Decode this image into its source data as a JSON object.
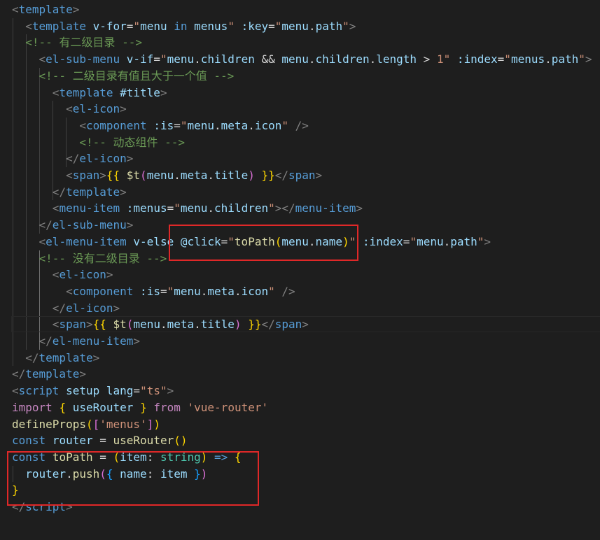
{
  "code_lines": [
    [
      {
        "t": "<",
        "c": "pun"
      },
      {
        "t": "template",
        "c": "tag"
      },
      {
        "t": ">",
        "c": "pun"
      }
    ],
    [
      {
        "t": "  "
      },
      {
        "t": "<",
        "c": "pun"
      },
      {
        "t": "template",
        "c": "tag"
      },
      {
        "t": " "
      },
      {
        "t": "v-for",
        "c": "attr"
      },
      {
        "t": "=",
        "c": "plain"
      },
      {
        "t": "\"",
        "c": "val"
      },
      {
        "t": "menu",
        "c": "var"
      },
      {
        "t": " "
      },
      {
        "t": "in",
        "c": "kw"
      },
      {
        "t": " "
      },
      {
        "t": "menus",
        "c": "var"
      },
      {
        "t": "\"",
        "c": "val"
      },
      {
        "t": " "
      },
      {
        "t": ":key",
        "c": "attr"
      },
      {
        "t": "=",
        "c": "plain"
      },
      {
        "t": "\"",
        "c": "val"
      },
      {
        "t": "menu",
        "c": "var"
      },
      {
        "t": ".",
        "c": "plain"
      },
      {
        "t": "path",
        "c": "var"
      },
      {
        "t": "\"",
        "c": "val"
      },
      {
        "t": ">",
        "c": "pun"
      }
    ],
    [
      {
        "t": "  "
      },
      {
        "t": "<!-- 有二级目录 -->",
        "c": "cmt"
      }
    ],
    [
      {
        "t": "    "
      },
      {
        "t": "<",
        "c": "pun"
      },
      {
        "t": "el-sub-menu",
        "c": "tag"
      },
      {
        "t": " "
      },
      {
        "t": "v-if",
        "c": "attr"
      },
      {
        "t": "=",
        "c": "plain"
      },
      {
        "t": "\"",
        "c": "val"
      },
      {
        "t": "menu",
        "c": "var"
      },
      {
        "t": ".",
        "c": "plain"
      },
      {
        "t": "children",
        "c": "var"
      },
      {
        "t": " && ",
        "c": "plain"
      },
      {
        "t": "menu",
        "c": "var"
      },
      {
        "t": ".",
        "c": "plain"
      },
      {
        "t": "children",
        "c": "var"
      },
      {
        "t": ".",
        "c": "plain"
      },
      {
        "t": "length",
        "c": "var"
      },
      {
        "t": " > ",
        "c": "plain"
      },
      {
        "t": "1",
        "c": "val"
      },
      {
        "t": "\"",
        "c": "val"
      },
      {
        "t": " "
      },
      {
        "t": ":index",
        "c": "attr"
      },
      {
        "t": "=",
        "c": "plain"
      },
      {
        "t": "\"",
        "c": "val"
      },
      {
        "t": "menus",
        "c": "var"
      },
      {
        "t": ".",
        "c": "plain"
      },
      {
        "t": "path",
        "c": "var"
      },
      {
        "t": "\"",
        "c": "val"
      },
      {
        "t": ">",
        "c": "pun"
      }
    ],
    [
      {
        "t": "    "
      },
      {
        "t": "<!-- 二级目录有值且大于一个值 -->",
        "c": "cmt"
      }
    ],
    [
      {
        "t": "      "
      },
      {
        "t": "<",
        "c": "pun"
      },
      {
        "t": "template",
        "c": "tag"
      },
      {
        "t": " "
      },
      {
        "t": "#title",
        "c": "attr"
      },
      {
        "t": ">",
        "c": "pun"
      }
    ],
    [
      {
        "t": "        "
      },
      {
        "t": "<",
        "c": "pun"
      },
      {
        "t": "el-icon",
        "c": "tag"
      },
      {
        "t": ">",
        "c": "pun"
      }
    ],
    [
      {
        "t": "          "
      },
      {
        "t": "<",
        "c": "pun"
      },
      {
        "t": "component",
        "c": "tag"
      },
      {
        "t": " "
      },
      {
        "t": ":is",
        "c": "attr"
      },
      {
        "t": "=",
        "c": "plain"
      },
      {
        "t": "\"",
        "c": "val"
      },
      {
        "t": "menu",
        "c": "var"
      },
      {
        "t": ".",
        "c": "plain"
      },
      {
        "t": "meta",
        "c": "var"
      },
      {
        "t": ".",
        "c": "plain"
      },
      {
        "t": "icon",
        "c": "var"
      },
      {
        "t": "\"",
        "c": "val"
      },
      {
        "t": " "
      },
      {
        "t": "/>",
        "c": "pun"
      }
    ],
    [
      {
        "t": "          "
      },
      {
        "t": "<!-- 动态组件 -->",
        "c": "cmt"
      }
    ],
    [
      {
        "t": "        "
      },
      {
        "t": "</",
        "c": "pun"
      },
      {
        "t": "el-icon",
        "c": "tag"
      },
      {
        "t": ">",
        "c": "pun"
      }
    ],
    [
      {
        "t": "        "
      },
      {
        "t": "<",
        "c": "pun"
      },
      {
        "t": "span",
        "c": "tag"
      },
      {
        "t": ">",
        "c": "pun"
      },
      {
        "t": "{{",
        "c": "b1"
      },
      {
        "t": " "
      },
      {
        "t": "$t",
        "c": "fn"
      },
      {
        "t": "(",
        "c": "b2"
      },
      {
        "t": "menu",
        "c": "var"
      },
      {
        "t": ".",
        "c": "plain"
      },
      {
        "t": "meta",
        "c": "var"
      },
      {
        "t": ".",
        "c": "plain"
      },
      {
        "t": "title",
        "c": "var"
      },
      {
        "t": ")",
        "c": "b2"
      },
      {
        "t": " "
      },
      {
        "t": "}}",
        "c": "b1"
      },
      {
        "t": "</",
        "c": "pun"
      },
      {
        "t": "span",
        "c": "tag"
      },
      {
        "t": ">",
        "c": "pun"
      }
    ],
    [
      {
        "t": "      "
      },
      {
        "t": "</",
        "c": "pun"
      },
      {
        "t": "template",
        "c": "tag"
      },
      {
        "t": ">",
        "c": "pun"
      }
    ],
    [
      {
        "t": "      "
      },
      {
        "t": "<",
        "c": "pun"
      },
      {
        "t": "menu-item",
        "c": "tag"
      },
      {
        "t": " "
      },
      {
        "t": ":menus",
        "c": "attr"
      },
      {
        "t": "=",
        "c": "plain"
      },
      {
        "t": "\"",
        "c": "val"
      },
      {
        "t": "menu",
        "c": "var"
      },
      {
        "t": ".",
        "c": "plain"
      },
      {
        "t": "children",
        "c": "var"
      },
      {
        "t": "\"",
        "c": "val"
      },
      {
        "t": ">",
        "c": "pun"
      },
      {
        "t": "</",
        "c": "pun"
      },
      {
        "t": "menu-item",
        "c": "tag"
      },
      {
        "t": ">",
        "c": "pun"
      }
    ],
    [
      {
        "t": "    "
      },
      {
        "t": "</",
        "c": "pun"
      },
      {
        "t": "el-sub-menu",
        "c": "tag"
      },
      {
        "t": ">",
        "c": "pun"
      }
    ],
    [
      {
        "t": "    "
      },
      {
        "t": "<",
        "c": "pun"
      },
      {
        "t": "el-menu-item",
        "c": "tag"
      },
      {
        "t": " "
      },
      {
        "t": "v-else",
        "c": "attr"
      },
      {
        "t": " "
      },
      {
        "t": "@click",
        "c": "attr"
      },
      {
        "t": "=",
        "c": "plain"
      },
      {
        "t": "\"",
        "c": "val"
      },
      {
        "t": "toPath",
        "c": "fn"
      },
      {
        "t": "(",
        "c": "b1"
      },
      {
        "t": "menu",
        "c": "var"
      },
      {
        "t": ".",
        "c": "plain"
      },
      {
        "t": "name",
        "c": "var"
      },
      {
        "t": ")",
        "c": "b1"
      },
      {
        "t": "\"",
        "c": "val"
      },
      {
        "t": " "
      },
      {
        "t": ":index",
        "c": "attr"
      },
      {
        "t": "=",
        "c": "plain"
      },
      {
        "t": "\"",
        "c": "val"
      },
      {
        "t": "menu",
        "c": "var"
      },
      {
        "t": ".",
        "c": "plain"
      },
      {
        "t": "path",
        "c": "var"
      },
      {
        "t": "\"",
        "c": "val"
      },
      {
        "t": ">",
        "c": "pun"
      }
    ],
    [
      {
        "t": "    "
      },
      {
        "t": "<!-- 没有二级目录 -->",
        "c": "cmt"
      }
    ],
    [
      {
        "t": "      "
      },
      {
        "t": "<",
        "c": "pun"
      },
      {
        "t": "el-icon",
        "c": "tag"
      },
      {
        "t": ">",
        "c": "pun"
      }
    ],
    [
      {
        "t": "        "
      },
      {
        "t": "<",
        "c": "pun"
      },
      {
        "t": "component",
        "c": "tag"
      },
      {
        "t": " "
      },
      {
        "t": ":is",
        "c": "attr"
      },
      {
        "t": "=",
        "c": "plain"
      },
      {
        "t": "\"",
        "c": "val"
      },
      {
        "t": "menu",
        "c": "var"
      },
      {
        "t": ".",
        "c": "plain"
      },
      {
        "t": "meta",
        "c": "var"
      },
      {
        "t": ".",
        "c": "plain"
      },
      {
        "t": "icon",
        "c": "var"
      },
      {
        "t": "\"",
        "c": "val"
      },
      {
        "t": " "
      },
      {
        "t": "/>",
        "c": "pun"
      }
    ],
    [
      {
        "t": "      "
      },
      {
        "t": "</",
        "c": "pun"
      },
      {
        "t": "el-icon",
        "c": "tag"
      },
      {
        "t": ">",
        "c": "pun"
      }
    ],
    [
      {
        "t": "      "
      },
      {
        "t": "<",
        "c": "pun"
      },
      {
        "t": "span",
        "c": "tag"
      },
      {
        "t": ">",
        "c": "pun"
      },
      {
        "t": "{{",
        "c": "b1"
      },
      {
        "t": " "
      },
      {
        "t": "$t",
        "c": "fn"
      },
      {
        "t": "(",
        "c": "b2"
      },
      {
        "t": "menu",
        "c": "var"
      },
      {
        "t": ".",
        "c": "plain"
      },
      {
        "t": "meta",
        "c": "var"
      },
      {
        "t": ".",
        "c": "plain"
      },
      {
        "t": "title",
        "c": "var"
      },
      {
        "t": ")",
        "c": "b2"
      },
      {
        "t": " "
      },
      {
        "t": "}}",
        "c": "b1"
      },
      {
        "t": "</",
        "c": "pun"
      },
      {
        "t": "span",
        "c": "tag"
      },
      {
        "t": ">",
        "c": "pun"
      }
    ],
    [
      {
        "t": "    "
      },
      {
        "t": "</",
        "c": "pun"
      },
      {
        "t": "el-menu-item",
        "c": "tag"
      },
      {
        "t": ">",
        "c": "pun"
      }
    ],
    [
      {
        "t": "  "
      },
      {
        "t": "</",
        "c": "pun"
      },
      {
        "t": "template",
        "c": "tag"
      },
      {
        "t": ">",
        "c": "pun"
      }
    ],
    [
      {
        "t": "</",
        "c": "pun"
      },
      {
        "t": "template",
        "c": "tag"
      },
      {
        "t": ">",
        "c": "pun"
      }
    ],
    [
      {
        "t": "<",
        "c": "pun"
      },
      {
        "t": "script",
        "c": "tag"
      },
      {
        "t": " "
      },
      {
        "t": "setup",
        "c": "attr"
      },
      {
        "t": " "
      },
      {
        "t": "lang",
        "c": "attr"
      },
      {
        "t": "=",
        "c": "plain"
      },
      {
        "t": "\"ts\"",
        "c": "val"
      },
      {
        "t": ">",
        "c": "pun"
      }
    ],
    [
      {
        "t": "import",
        "c": "ctrl"
      },
      {
        "t": " "
      },
      {
        "t": "{",
        "c": "b1"
      },
      {
        "t": " "
      },
      {
        "t": "useRouter",
        "c": "var"
      },
      {
        "t": " "
      },
      {
        "t": "}",
        "c": "b1"
      },
      {
        "t": " "
      },
      {
        "t": "from",
        "c": "ctrl"
      },
      {
        "t": " "
      },
      {
        "t": "'vue-router'",
        "c": "val"
      }
    ],
    [
      {
        "t": "defineProps",
        "c": "fn"
      },
      {
        "t": "(",
        "c": "b1"
      },
      {
        "t": "[",
        "c": "b2"
      },
      {
        "t": "'menus'",
        "c": "val"
      },
      {
        "t": "]",
        "c": "b2"
      },
      {
        "t": ")",
        "c": "b1"
      }
    ],
    [
      {
        "t": "const",
        "c": "kw"
      },
      {
        "t": " "
      },
      {
        "t": "router",
        "c": "var"
      },
      {
        "t": " = ",
        "c": "plain"
      },
      {
        "t": "useRouter",
        "c": "fn"
      },
      {
        "t": "(",
        "c": "b1"
      },
      {
        "t": ")",
        "c": "b1"
      }
    ],
    [
      {
        "t": "const",
        "c": "kw"
      },
      {
        "t": " "
      },
      {
        "t": "toPath",
        "c": "fn"
      },
      {
        "t": " = ",
        "c": "plain"
      },
      {
        "t": "(",
        "c": "b1"
      },
      {
        "t": "item",
        "c": "var"
      },
      {
        "t": ": ",
        "c": "plain"
      },
      {
        "t": "string",
        "c": "type"
      },
      {
        "t": ")",
        "c": "b1"
      },
      {
        "t": " "
      },
      {
        "t": "=>",
        "c": "kw"
      },
      {
        "t": " "
      },
      {
        "t": "{",
        "c": "b1"
      }
    ],
    [
      {
        "t": "  "
      },
      {
        "t": "router",
        "c": "var"
      },
      {
        "t": ".",
        "c": "plain"
      },
      {
        "t": "push",
        "c": "fn"
      },
      {
        "t": "(",
        "c": "b2"
      },
      {
        "t": "{",
        "c": "b3"
      },
      {
        "t": " "
      },
      {
        "t": "name",
        "c": "var"
      },
      {
        "t": ": ",
        "c": "plain"
      },
      {
        "t": "item",
        "c": "var"
      },
      {
        "t": " "
      },
      {
        "t": "}",
        "c": "b3"
      },
      {
        "t": ")",
        "c": "b2"
      }
    ],
    [
      {
        "t": "}",
        "c": "b1"
      }
    ],
    [
      {
        "t": "</",
        "c": "pun"
      },
      {
        "t": "script",
        "c": "tag"
      },
      {
        "t": ">",
        "c": "pun"
      }
    ]
  ],
  "theme": {
    "background": "#1e1e1e",
    "highlight_border": "#e02828"
  }
}
